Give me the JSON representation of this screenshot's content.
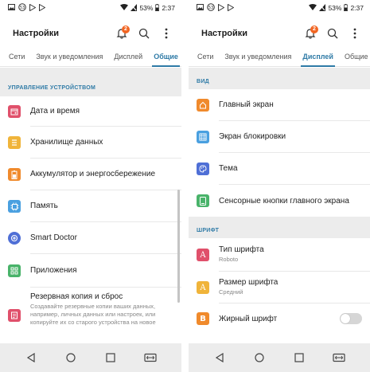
{
  "status_bar": {
    "battery": "53%",
    "time": "2:37"
  },
  "colors": {
    "accent": "#2e7aa6",
    "badge": "#f26522",
    "section_bg": "#ececec"
  },
  "left": {
    "title": "Настройки",
    "notification_count": "2",
    "tabs": [
      "Сети",
      "Звук и уведомления",
      "Дисплей",
      "Общие"
    ],
    "active_tab": "Общие",
    "section": "УПРАВЛЕНИЕ УСТРОЙСТВОМ",
    "items": [
      {
        "label": "Дата и время",
        "icon": "calendar-icon",
        "color": "#e0506b"
      },
      {
        "label": "Хранилище данных",
        "icon": "storage-icon",
        "color": "#f0b43a"
      },
      {
        "label": "Аккумулятор и энергосбережение",
        "icon": "battery-icon",
        "color": "#f08a2c"
      },
      {
        "label": "Память",
        "icon": "chip-icon",
        "color": "#4aa0e0"
      },
      {
        "label": "Smart Doctor",
        "icon": "smart-doctor-icon",
        "color": "#4f6fd6"
      },
      {
        "label": "Приложения",
        "icon": "apps-grid-icon",
        "color": "#49b36a"
      },
      {
        "label": "Резервная копия и сброс",
        "sub": "Создавайте резервные копии ваших данных, например, личных данных или настроек, или копируйте их со старого устройства на новое",
        "icon": "backup-icon",
        "color": "#e0506b"
      }
    ]
  },
  "right": {
    "title": "Настройки",
    "notification_count": "2",
    "tabs": [
      "Сети",
      "Звук и уведомления",
      "Дисплей",
      "Общие"
    ],
    "active_tab": "Дисплей",
    "section_view": "ВИД",
    "view_items": [
      {
        "label": "Главный экран",
        "icon": "home-icon",
        "color": "#f08a2c"
      },
      {
        "label": "Экран блокировки",
        "icon": "lock-grid-icon",
        "color": "#4aa0e0"
      },
      {
        "label": "Тема",
        "icon": "palette-icon",
        "color": "#4f6fd6"
      },
      {
        "label": "Сенсорные кнопки главного экрана",
        "icon": "nav-buttons-icon",
        "color": "#49b36a"
      }
    ],
    "section_font": "ШРИФТ",
    "font_items": [
      {
        "label": "Тип шрифта",
        "sub": "Roboto",
        "icon": "font-type-icon",
        "color": "#e0506b",
        "glyph": "A"
      },
      {
        "label": "Размер шрифта",
        "sub": "Средний",
        "icon": "font-size-icon",
        "color": "#f0b43a",
        "glyph": "A"
      },
      {
        "label": "Жирный шрифт",
        "icon": "bold-font-icon",
        "color": "#f08a2c",
        "glyph": "B"
      }
    ],
    "bold_toggle": false
  }
}
